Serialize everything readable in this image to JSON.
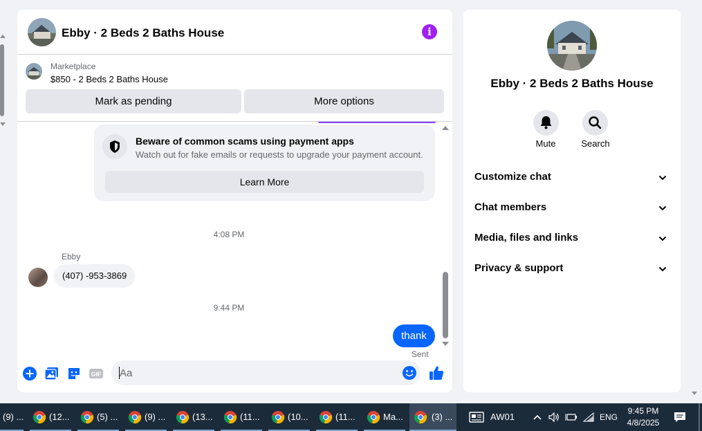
{
  "chat": {
    "title": "Ebby · 2 Beds 2 Baths House",
    "listing": {
      "source": "Marketplace",
      "price_title": "$850 - 2 Beds 2 Baths House",
      "pending_label": "Mark as pending",
      "more_label": "More options"
    },
    "warning": {
      "title": "Beware of common scams using payment apps",
      "text": "Watch out for fake emails or requests to upgrade your payment account.",
      "learn_label": "Learn More"
    },
    "messages": {
      "time1": "4:08 PM",
      "sender": "Ebby",
      "incoming": "(407) -953-3869",
      "time2": "9:44 PM",
      "outgoing": "thank",
      "sent_label": "Sent"
    },
    "composer": {
      "placeholder": "Aa"
    },
    "accent": "#0866ff"
  },
  "side": {
    "title": "Ebby · 2 Beds 2 Baths House",
    "mute_label": "Mute",
    "search_label": "Search",
    "menu": [
      {
        "label": "Customize chat"
      },
      {
        "label": "Chat members"
      },
      {
        "label": "Media, files and links"
      },
      {
        "label": "Privacy & support"
      }
    ]
  },
  "taskbar": {
    "items": [
      {
        "label": "(9) ..."
      },
      {
        "label": "(12..."
      },
      {
        "label": "(5) ..."
      },
      {
        "label": "(9) ..."
      },
      {
        "label": "(13..."
      },
      {
        "label": "(11..."
      },
      {
        "label": "(10..."
      },
      {
        "label": "(11..."
      },
      {
        "label": "Ma..."
      },
      {
        "label": "(3) ..."
      }
    ],
    "tray_app": "AW01",
    "lang": "ENG",
    "time": "9:45 PM",
    "date": "4/8/2025"
  }
}
